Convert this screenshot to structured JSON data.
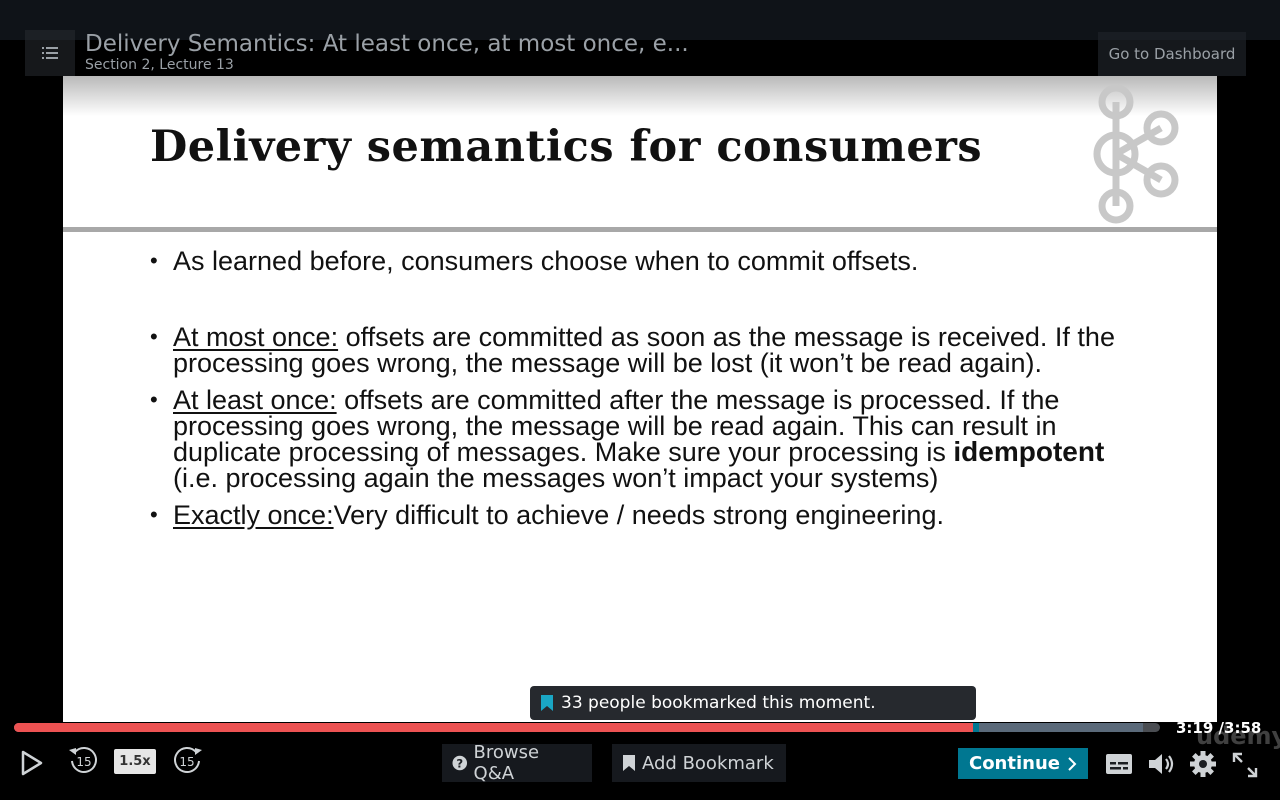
{
  "header": {
    "lecture_title": "Delivery Semantics: At least once, at most once, e...",
    "lecture_subtitle": "Section 2, Lecture 13",
    "dashboard_label": "Go to Dashboard"
  },
  "slide": {
    "title": "Delivery semantics for consumers",
    "bullets": {
      "b1": "As learned before, consumers choose when to commit offsets.",
      "b2_term": "At most once:",
      "b2_text": " offsets are committed as soon as the message is received. If the processing goes wrong, the message will be lost (it won’t be read again).",
      "b3_term": "At least once:",
      "b3_text_a": " offsets are committed after the message is processed. If the processing goes wrong, the message will be read again. This can result in duplicate processing of messages. Make sure your processing is ",
      "b3_strong": "idempotent",
      "b3_text_b": " (i.e. processing again the messages won’t impact your systems)",
      "b4_term": "Exactly once:",
      "b4_text": "Very difficult to achieve / needs strong engineering."
    },
    "bullet_symbol": "•"
  },
  "tooltip": {
    "text": "33 people bookmarked this moment.",
    "icon": "bookmark-icon"
  },
  "player": {
    "current_time": "3:19",
    "duration": "/3:58",
    "progress_fraction": 0.837,
    "buffered_fraction": 0.985,
    "playback_rate": "1.5x",
    "rewind_label": "15",
    "forward_label": "15",
    "watermark": "udemy",
    "browse_qa_label": "Browse Q&A",
    "add_bookmark_label": "Add Bookmark",
    "continue_label": "Continue",
    "colors": {
      "progress": "#ec5252",
      "accent": "#007791"
    }
  }
}
